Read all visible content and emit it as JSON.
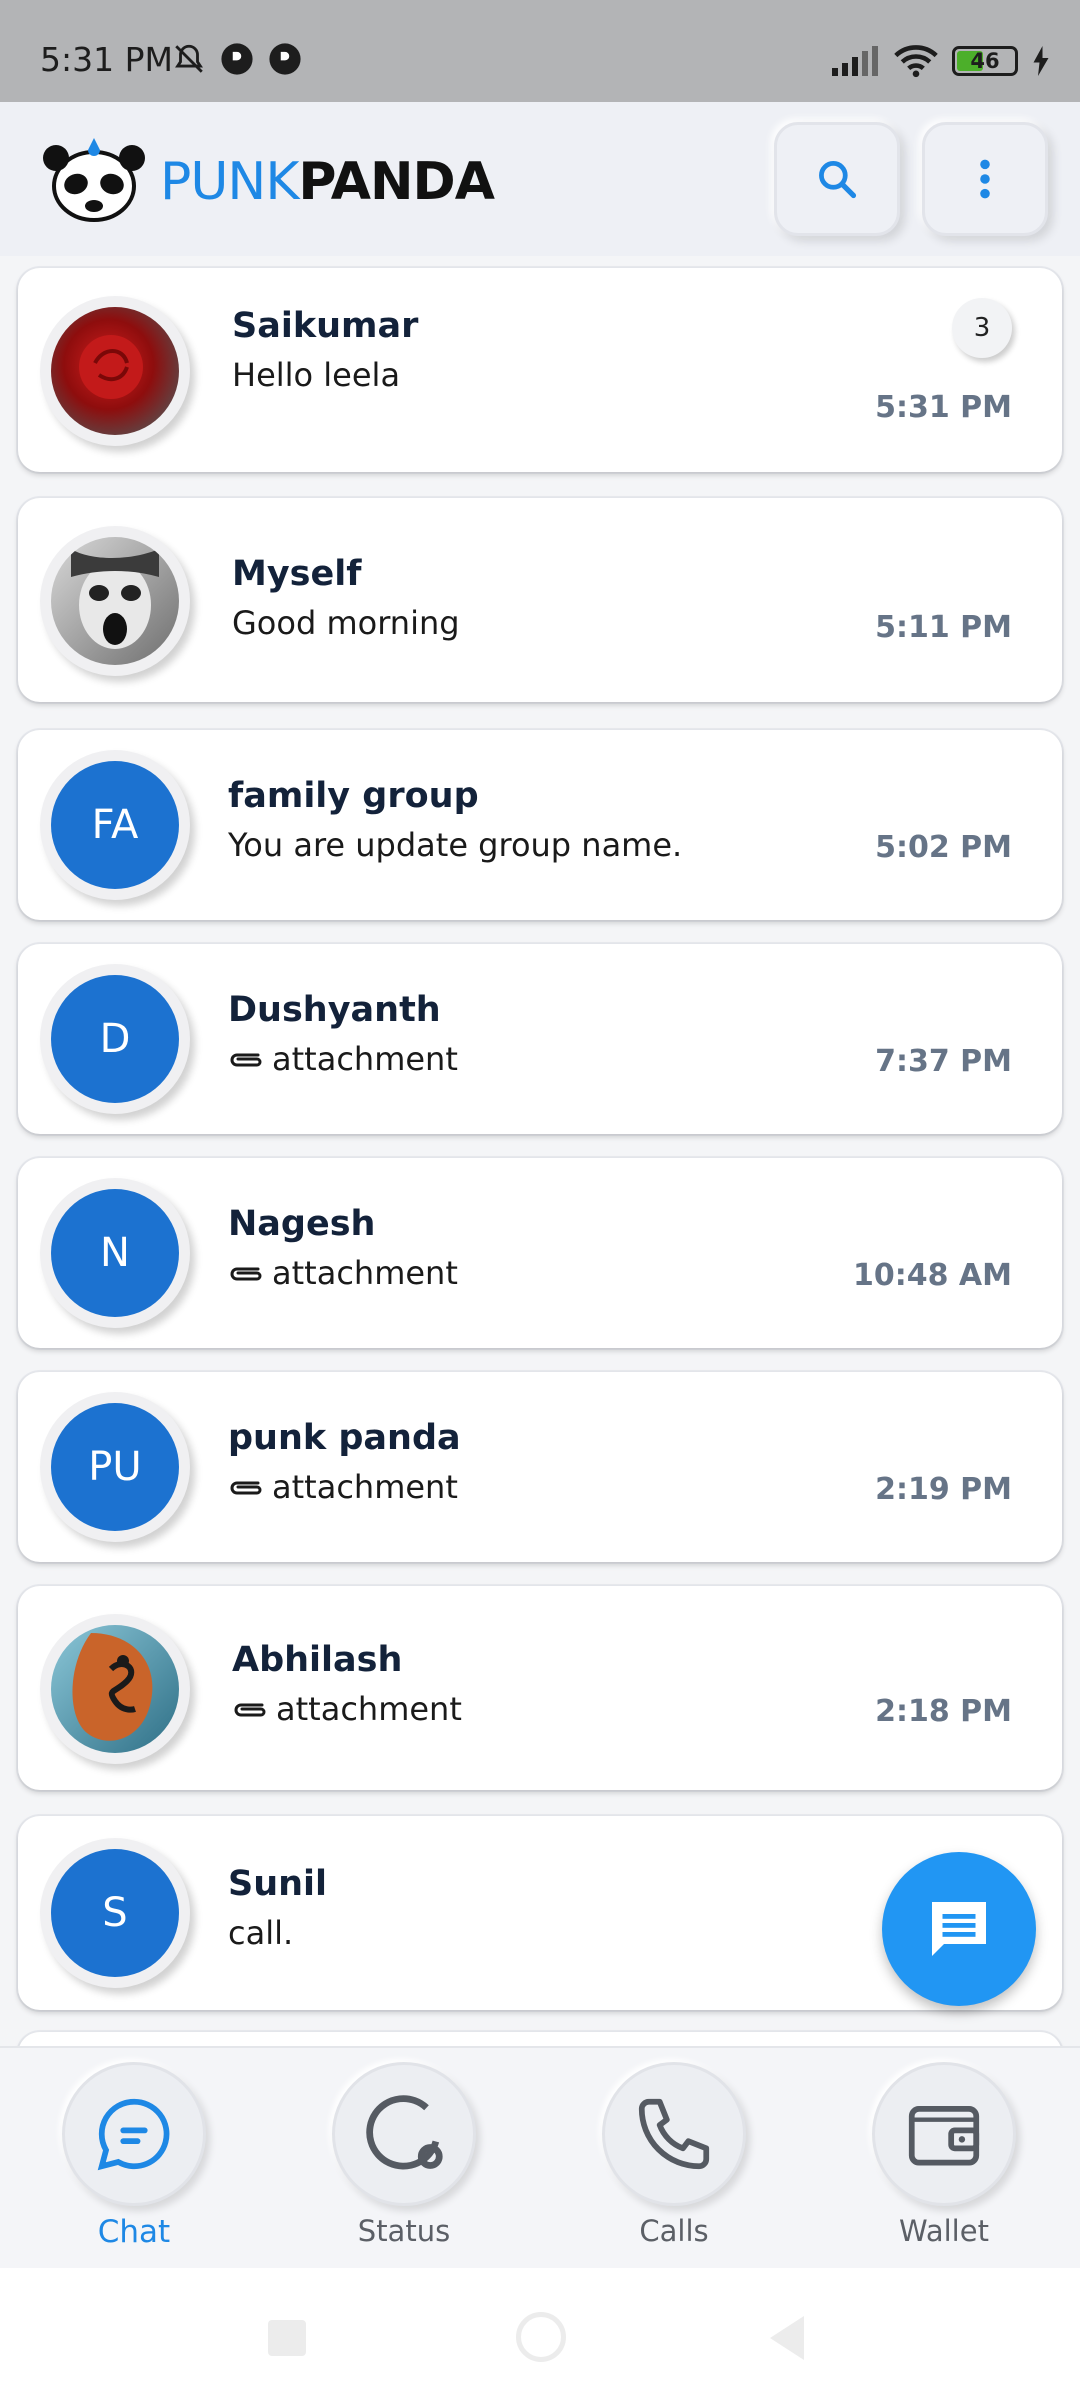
{
  "status_bar": {
    "time": "5:31 PM",
    "battery": "46"
  },
  "header": {
    "brand_part1": "PUNK",
    "brand_part2": "PANDA",
    "search_icon": "search-icon",
    "menu_icon": "more-vert-icon"
  },
  "chats": [
    {
      "name": "Saikumar",
      "message": "Hello leela",
      "time": "5:31 PM",
      "unread": "3",
      "avatar_type": "photo-red-flower",
      "attachment": false
    },
    {
      "name": "Myself",
      "message": "Good morning",
      "time": "5:11 PM",
      "avatar_type": "photo-face",
      "attachment": false
    },
    {
      "name": "family group",
      "message": "You are update group name.",
      "time": "5:02 PM",
      "initials": "FA",
      "attachment": false
    },
    {
      "name": "Dushyanth",
      "message": "attachment",
      "time": "7:37 PM",
      "initials": "D",
      "attachment": true
    },
    {
      "name": "Nagesh",
      "message": "attachment",
      "time": "10:48 AM",
      "initials": "N",
      "attachment": true
    },
    {
      "name": "punk panda",
      "message": "attachment",
      "time": "2:19 PM",
      "initials": "PU",
      "attachment": true
    },
    {
      "name": "Abhilash",
      "message": "attachment",
      "time": "2:18 PM",
      "avatar_type": "photo-art",
      "attachment": true
    },
    {
      "name": "Sunil",
      "message": "call.",
      "time": "",
      "initials": "S",
      "attachment": false
    }
  ],
  "bottom_nav": [
    {
      "label": "Chat",
      "icon": "chat-bubble-icon",
      "active": true
    },
    {
      "label": "Status",
      "icon": "status-icon",
      "active": false
    },
    {
      "label": "Calls",
      "icon": "phone-icon",
      "active": false
    },
    {
      "label": "Wallet",
      "icon": "wallet-icon",
      "active": false
    }
  ],
  "colors": {
    "accent": "#1e88e5",
    "avatar_bg": "#1c72d0",
    "fab": "#2196f3"
  }
}
